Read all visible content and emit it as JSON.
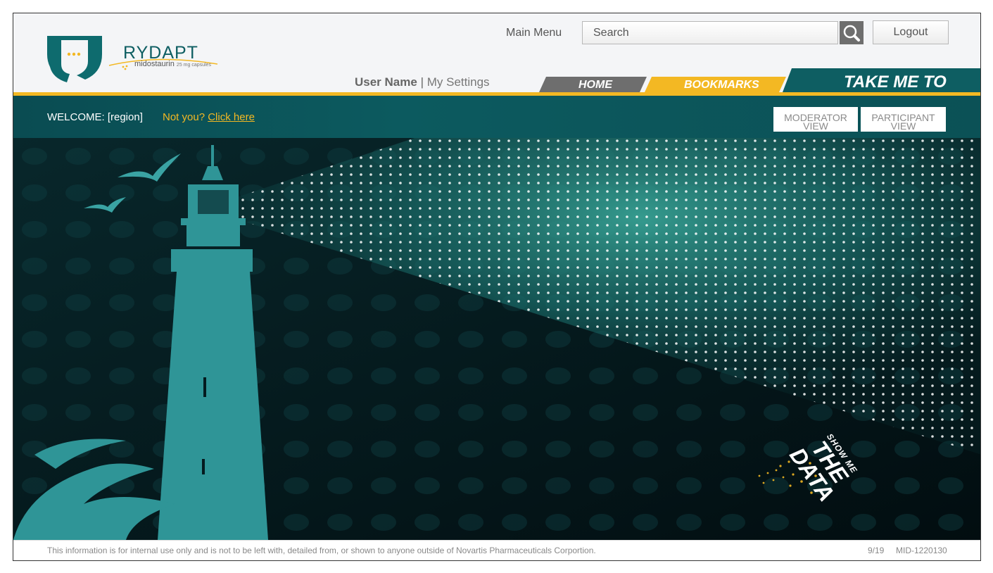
{
  "header": {
    "brand_name": "RYDAPT",
    "brand_subtitle": "midostaurin",
    "brand_dose": "25 mg capsules",
    "main_menu": "Main Menu",
    "search_placeholder": "Search",
    "logout_label": "Logout",
    "user_name": "User Name",
    "separator": "|",
    "my_settings": "My Settings"
  },
  "nav": {
    "home": "HOME",
    "bookmarks": "BOOKMARKS",
    "take_me_to": "TAKE ME TO"
  },
  "welcome": {
    "label": "WELCOME: [region]",
    "not_you": "Not you?",
    "click_here": "Click here",
    "moderator_line1": "MODERATOR",
    "moderator_line2": "VIEW",
    "participant_line1": "PARTICIPANT",
    "participant_line2": "VIEW"
  },
  "hero": {
    "tagline_small": "SHOW ME",
    "tagline_big1": "THE",
    "tagline_big2": "DATA"
  },
  "footer": {
    "disclaimer": "This information is for internal use only and is not to be left with, detailed from, or shown to anyone outside of Novartis Pharmaceuticals Corportion.",
    "date": "9/19",
    "code": "MID-1220130"
  },
  "colors": {
    "teal": "#0e5e62",
    "gold": "#f3b823",
    "nav_gray": "#6e6e6e"
  }
}
